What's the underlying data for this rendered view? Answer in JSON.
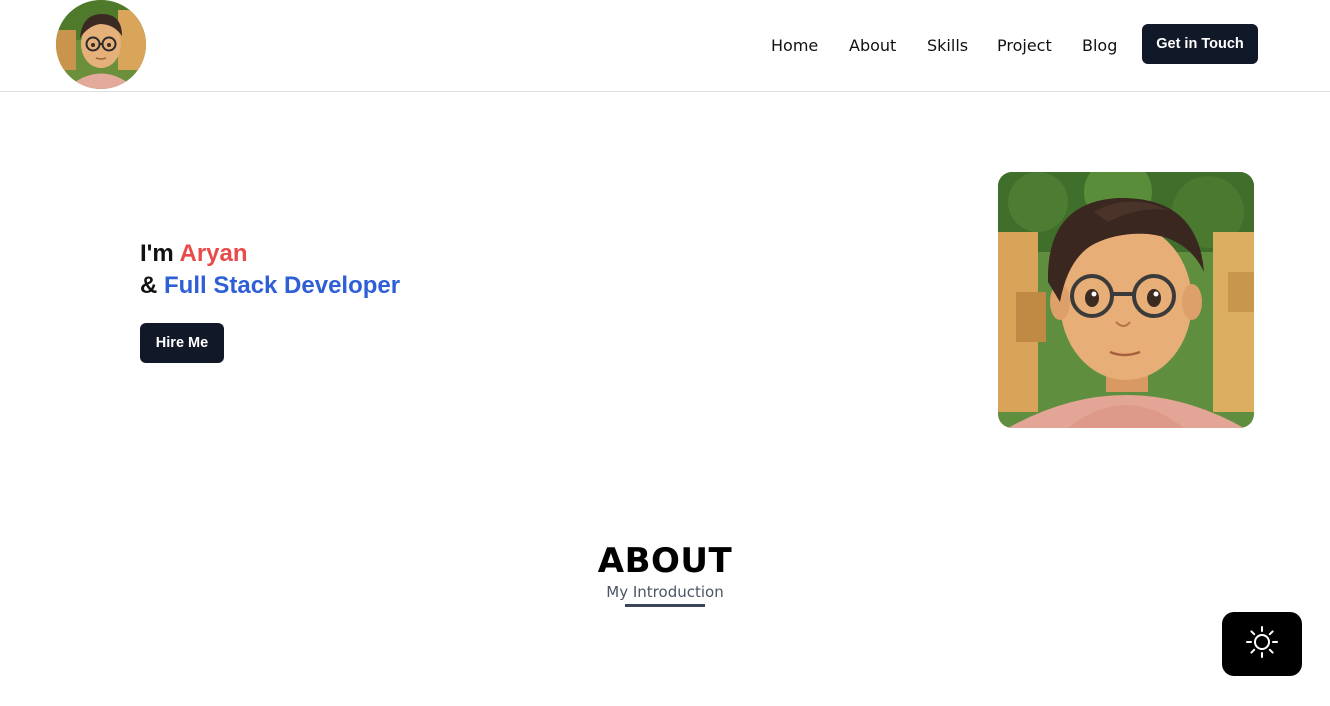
{
  "nav": {
    "items": [
      {
        "label": "Home"
      },
      {
        "label": "About"
      },
      {
        "label": "Skills"
      },
      {
        "label": "Project"
      },
      {
        "label": "Blog"
      }
    ],
    "cta_label": "Get in Touch"
  },
  "hero": {
    "greeting": "I'm",
    "name": "Aryan",
    "connector": "&",
    "role": "Full Stack Developer",
    "hire_label": "Hire Me"
  },
  "about": {
    "title": "ABOUT",
    "subtitle": "My Introduction"
  },
  "colors": {
    "accent_red": "#e94a4a",
    "accent_blue": "#2f5fd6",
    "button_dark": "#111827",
    "toggle_bg": "#000000"
  },
  "icons": {
    "theme_toggle": "sun-icon"
  }
}
